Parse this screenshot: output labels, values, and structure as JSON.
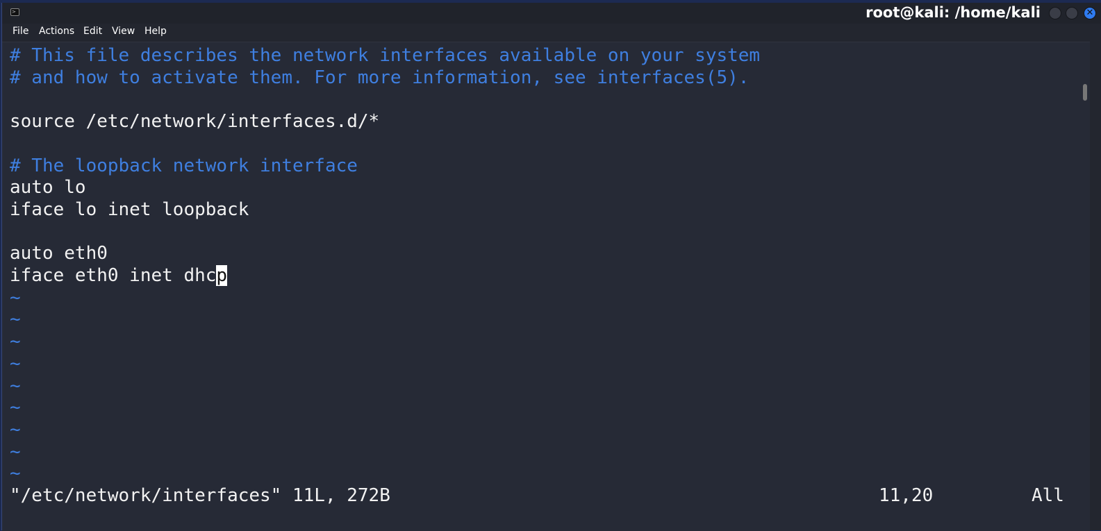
{
  "window": {
    "title": "root@kali: /home/kali",
    "icon": "terminal-icon"
  },
  "menu": [
    "File",
    "Actions",
    "Edit",
    "View",
    "Help"
  ],
  "editor": {
    "lines": [
      {
        "text": "# This file describes the network interfaces available on your system",
        "type": "comment"
      },
      {
        "text": "# and how to activate them. For more information, see interfaces(5).",
        "type": "comment"
      },
      {
        "text": "",
        "type": "code"
      },
      {
        "text": "source /etc/network/interfaces.d/*",
        "type": "code"
      },
      {
        "text": "",
        "type": "code"
      },
      {
        "text": "# The loopback network interface",
        "type": "comment"
      },
      {
        "text": "auto lo",
        "type": "code"
      },
      {
        "text": "iface lo inet loopback",
        "type": "code"
      },
      {
        "text": "",
        "type": "code"
      },
      {
        "text": "auto eth0",
        "type": "code"
      },
      {
        "text": "iface eth0 inet dhc",
        "type": "code",
        "cursor_char": "p"
      }
    ],
    "empty_line_marker": "~",
    "empty_line_count": 9
  },
  "status": {
    "file_info": "\"/etc/network/interfaces\" 11L, 272B",
    "position": "11,20",
    "scroll": "All"
  },
  "colors": {
    "comment": "#3f7fe0",
    "text": "#f2f2f2",
    "background": "#262a36",
    "close_button": "#2f7bf0"
  }
}
